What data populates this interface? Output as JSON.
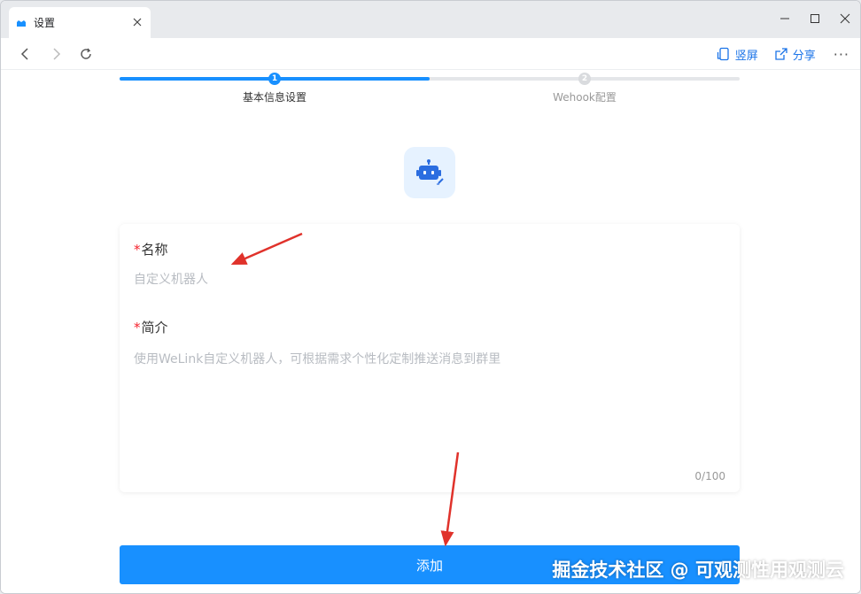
{
  "tab": {
    "title": "设置"
  },
  "nav": {
    "rotate_label": "竖屏",
    "share_label": "分享",
    "more": "···"
  },
  "steps": [
    {
      "number": "1",
      "label": "基本信息设置",
      "status": "active"
    },
    {
      "number": "2",
      "label": "Wehook配置",
      "status": "inactive"
    }
  ],
  "form": {
    "name": {
      "required_mark": "*",
      "label": "名称",
      "value": "",
      "placeholder": "自定义机器人"
    },
    "description": {
      "required_mark": "*",
      "label": "简介",
      "value": "",
      "placeholder": "使用WeLink自定义机器人，可根据需求个性化定制推送消息到群里",
      "char_count": "0/100"
    }
  },
  "actions": {
    "add_label": "添加"
  },
  "watermark": "掘金技术社区 @ 可观测性用观测云",
  "colors": {
    "primary": "#1890ff",
    "required": "#f5222d",
    "annotation": "#e0322b"
  }
}
